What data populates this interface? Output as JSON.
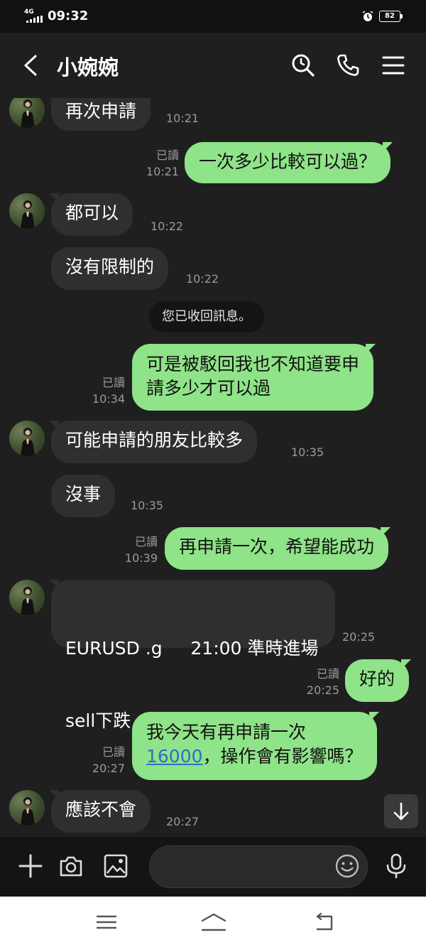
{
  "status_bar": {
    "network": "4G",
    "time": "09:32",
    "battery": "82"
  },
  "header": {
    "title": "小婉婉"
  },
  "messages": [
    {
      "dir": "in",
      "text": "再次申請",
      "time": "10:21"
    },
    {
      "dir": "out",
      "text": "一次多少比較可以過？",
      "read": "已讀",
      "time": "10:21"
    },
    {
      "dir": "in",
      "text": "都可以",
      "time": "10:22"
    },
    {
      "dir": "in",
      "text": "沒有限制的",
      "time": "10:22"
    },
    {
      "dir": "system",
      "text": "您已收回訊息。"
    },
    {
      "dir": "out",
      "line1": "可是被駁回我也不知道要申",
      "line2": "請多少才可以過",
      "read": "已讀",
      "time": "10:34"
    },
    {
      "dir": "in",
      "text": "可能申請的朋友比較多",
      "time": "10:35"
    },
    {
      "dir": "in",
      "text": "沒事",
      "time": "10:35"
    },
    {
      "dir": "out",
      "text": "再申請一次，希望能成功",
      "read": "已讀",
      "time": "10:39"
    },
    {
      "dir": "in",
      "line1": "EURUSD .g     21:00 準時進場",
      "line2": "sell下跌",
      "time": "20:25"
    },
    {
      "dir": "out",
      "text": "好的",
      "read": "已讀",
      "time": "20:25"
    },
    {
      "dir": "out",
      "line1": "我今天有再申請一次",
      "link": "16000",
      "line2_rest": "，操作會有影響嗎？",
      "read": "已讀",
      "time": "20:27"
    },
    {
      "dir": "in",
      "text": "應該不會",
      "time": "20:27"
    }
  ],
  "colors": {
    "incoming_bubble": "#2f2f2f",
    "outgoing_bubble": "#8fe388",
    "background": "#1f1f1f",
    "link": "#2e6fc4"
  }
}
